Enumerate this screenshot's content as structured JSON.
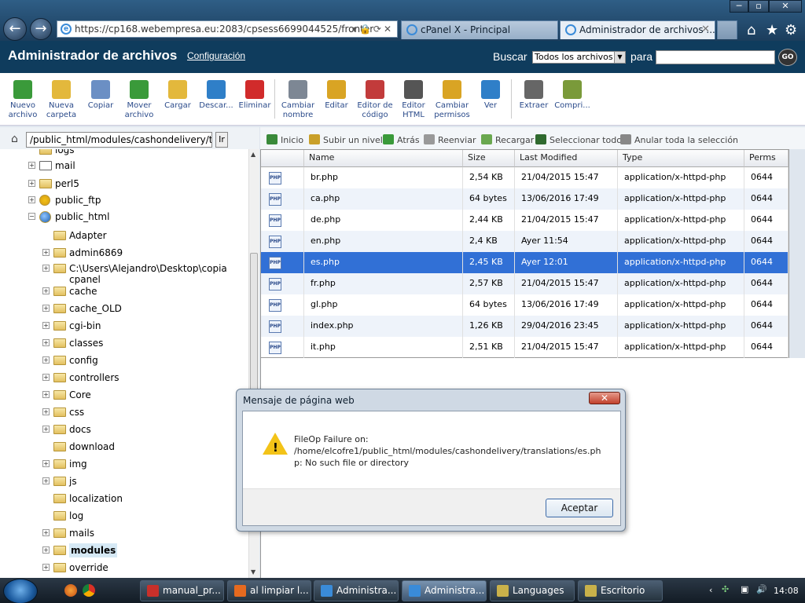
{
  "browser": {
    "address": "https://cp168.webempresa.eu:2083/cpsess6699044525/fronter",
    "tabs": [
      {
        "label": "cPanel X - Principal",
        "active": false
      },
      {
        "label": "Administrador de archivos ...",
        "active": true
      }
    ],
    "window_controls": [
      "─",
      "▫",
      "✕"
    ],
    "commands": [
      "home-icon",
      "star-icon",
      "gear-icon"
    ]
  },
  "header": {
    "title": "Administrador de archivos",
    "config_link": "Configuración",
    "search_label": "Buscar",
    "search_scope": "Todos los archivos",
    "para_label": "para",
    "search_value": "",
    "go_label": "GO"
  },
  "toolbar": {
    "items": [
      {
        "label": "Nuevo archivo",
        "icon": "new-file-icon",
        "color": "#3a9a3a"
      },
      {
        "label": "Nueva carpeta",
        "icon": "new-folder-icon",
        "color": "#e3b83c"
      },
      {
        "label": "Copiar",
        "icon": "copy-icon",
        "color": "#6b8fc4"
      },
      {
        "label": "Mover archivo",
        "icon": "move-file-icon",
        "color": "#3a9a3a"
      },
      {
        "label": "Cargar",
        "icon": "upload-icon",
        "color": "#e3b83c"
      },
      {
        "label": "Descar...",
        "icon": "download-icon",
        "color": "#2f7fc8"
      },
      {
        "label": "Eliminar",
        "icon": "delete-icon",
        "color": "#d12b2b"
      },
      {
        "label": "Cambiar nombre",
        "icon": "rename-icon",
        "color": "#7d8794"
      },
      {
        "label": "Editar",
        "icon": "edit-icon",
        "color": "#d9a424"
      },
      {
        "label": "Editor de código",
        "icon": "code-editor-icon",
        "color": "#c23b3b"
      },
      {
        "label": "Editor HTML",
        "icon": "html-editor-icon",
        "color": "#555555"
      },
      {
        "label": "Cambiar permisos",
        "icon": "permissions-icon",
        "color": "#d9a424"
      },
      {
        "label": "Ver",
        "icon": "view-icon",
        "color": "#2f7fc8"
      },
      {
        "label": "Extraer",
        "icon": "extract-icon",
        "color": "#666666"
      },
      {
        "label": "Compri...",
        "icon": "compress-icon",
        "color": "#7a9a3a"
      }
    ]
  },
  "path": {
    "value": "/public_html/modules/cashondelivery/trar",
    "go_label": "Ir"
  },
  "tree": [
    {
      "label": "logs",
      "expander": "",
      "level": 1
    },
    {
      "label": "mail",
      "expander": "+",
      "level": 1
    },
    {
      "label": "perl5",
      "expander": "+",
      "level": 1
    },
    {
      "label": "public_ftp",
      "expander": "+",
      "level": 1
    },
    {
      "label": "public_html",
      "expander": "−",
      "level": 1
    },
    {
      "label": "Adapter",
      "expander": "",
      "level": 2
    },
    {
      "label": "admin6869",
      "expander": "+",
      "level": 2
    },
    {
      "label": "C:\\Users\\Alejandro\\Desktop\\copia",
      "label2": "cpanel",
      "expander": "+",
      "level": 2
    },
    {
      "label": "cache",
      "expander": "+",
      "level": 2
    },
    {
      "label": "cache_OLD",
      "expander": "+",
      "level": 2
    },
    {
      "label": "cgi-bin",
      "expander": "+",
      "level": 2
    },
    {
      "label": "classes",
      "expander": "+",
      "level": 2
    },
    {
      "label": "config",
      "expander": "+",
      "level": 2
    },
    {
      "label": "controllers",
      "expander": "+",
      "level": 2
    },
    {
      "label": "Core",
      "expander": "+",
      "level": 2
    },
    {
      "label": "css",
      "expander": "+",
      "level": 2
    },
    {
      "label": "docs",
      "expander": "+",
      "level": 2
    },
    {
      "label": "download",
      "expander": "",
      "level": 2
    },
    {
      "label": "img",
      "expander": "+",
      "level": 2
    },
    {
      "label": "js",
      "expander": "+",
      "level": 2
    },
    {
      "label": "localization",
      "expander": "",
      "level": 2
    },
    {
      "label": "log",
      "expander": "",
      "level": 2
    },
    {
      "label": "mails",
      "expander": "+",
      "level": 2
    },
    {
      "label": "modules",
      "expander": "+",
      "level": 2,
      "selected": true
    },
    {
      "label": "override",
      "expander": "+",
      "level": 2
    }
  ],
  "navbar": [
    {
      "label": "Inicio",
      "icon": "home-icon",
      "color": "#3a8a3a"
    },
    {
      "label": "Subir un nivel",
      "icon": "up-level-icon",
      "color": "#c9a02a"
    },
    {
      "label": "Atrás",
      "icon": "back-icon",
      "color": "#3a9a3a"
    },
    {
      "label": "Reenviar",
      "icon": "forward-icon",
      "color": "#999999"
    },
    {
      "label": "Recargar",
      "icon": "reload-icon",
      "color": "#6aa84f"
    },
    {
      "label": "Seleccionar todo",
      "icon": "select-all-icon",
      "color": "#2f6a2f"
    },
    {
      "label": "Anular toda la selección",
      "icon": "deselect-all-icon",
      "color": "#888888"
    }
  ],
  "columns": [
    "Name",
    "Size",
    "Last Modified",
    "Type",
    "Perms"
  ],
  "files": [
    {
      "name": "br.php",
      "size": "2,54 KB",
      "modified": "21/04/2015 15:47",
      "type": "application/x-httpd-php",
      "perms": "0644"
    },
    {
      "name": "ca.php",
      "size": "64 bytes",
      "modified": "13/06/2016 17:49",
      "type": "application/x-httpd-php",
      "perms": "0644"
    },
    {
      "name": "de.php",
      "size": "2,44 KB",
      "modified": "21/04/2015 15:47",
      "type": "application/x-httpd-php",
      "perms": "0644"
    },
    {
      "name": "en.php",
      "size": "2,4 KB",
      "modified": "Ayer 11:54",
      "type": "application/x-httpd-php",
      "perms": "0644"
    },
    {
      "name": "es.php",
      "size": "2,45 KB",
      "modified": "Ayer 12:01",
      "type": "application/x-httpd-php",
      "perms": "0644",
      "selected": true
    },
    {
      "name": "fr.php",
      "size": "2,57 KB",
      "modified": "21/04/2015 15:47",
      "type": "application/x-httpd-php",
      "perms": "0644"
    },
    {
      "name": "gl.php",
      "size": "64 bytes",
      "modified": "13/06/2016 17:49",
      "type": "application/x-httpd-php",
      "perms": "0644"
    },
    {
      "name": "index.php",
      "size": "1,26 KB",
      "modified": "29/04/2016 23:45",
      "type": "application/x-httpd-php",
      "perms": "0644"
    },
    {
      "name": "it.php",
      "size": "2,51 KB",
      "modified": "21/04/2015 15:47",
      "type": "application/x-httpd-php",
      "perms": "0644"
    }
  ],
  "file_icon_text": "PHP",
  "dialog": {
    "title": "Mensaje de página web",
    "close": "✕",
    "message_line1": "FileOp Failure on:",
    "message_line2": "/home/elcofre1/public_html/modules/cashondelivery/translations/es.php: No such file or directory",
    "ok_label": "Aceptar",
    "warn_mark": "!"
  },
  "taskbar": {
    "tasks": [
      {
        "label": "manual_pr...",
        "icon": "pdf-icon",
        "color": "#c8302a"
      },
      {
        "label": "al limpiar l...",
        "icon": "firefox-icon",
        "color": "#e66a1f"
      },
      {
        "label": "Administra...",
        "icon": "ie-icon",
        "color": "#3a8bd8"
      },
      {
        "label": "Administra...",
        "icon": "ie-icon",
        "color": "#3a8bd8",
        "active": true
      },
      {
        "label": "Languages",
        "icon": "folder-icon",
        "color": "#c9b14a"
      },
      {
        "label": "Escritorio",
        "icon": "folder-icon",
        "color": "#c9b14a"
      }
    ],
    "clock": "14:08"
  }
}
